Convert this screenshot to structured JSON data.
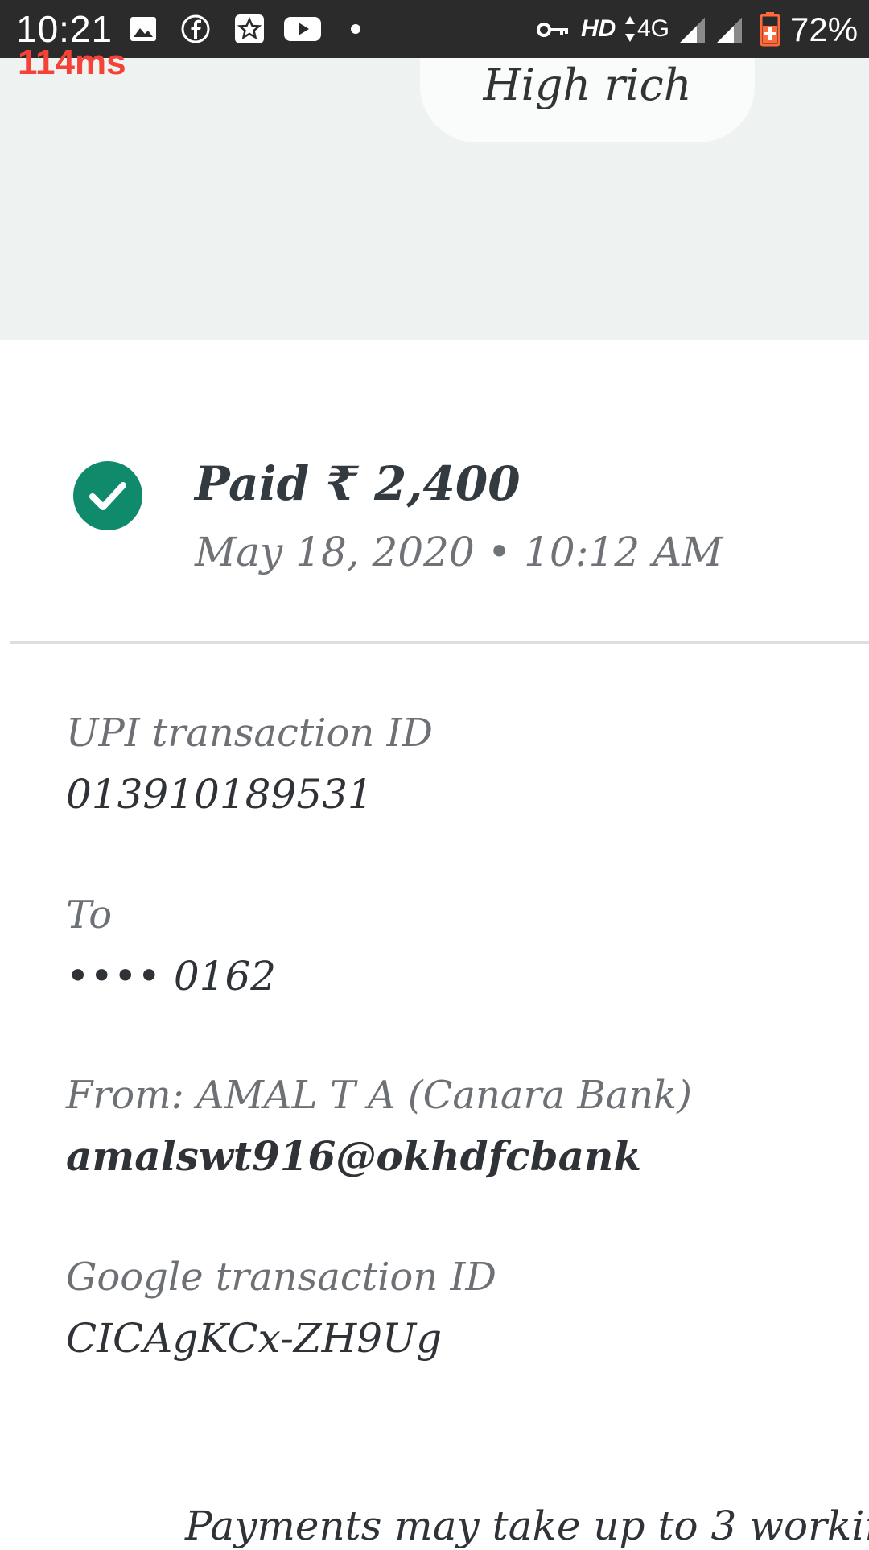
{
  "status_bar": {
    "time": "10:21",
    "perf_overlay": "114ms",
    "hd": "HD",
    "network": "4G",
    "battery": "72%",
    "icons": [
      "gallery-icon",
      "facebook-icon",
      "star-app-icon",
      "youtube-icon",
      "notification-dot",
      "vpn-key-icon",
      "data-arrows-icon",
      "signal-icon",
      "signal-icon",
      "battery-icon"
    ]
  },
  "note": {
    "text": "High rich"
  },
  "payment": {
    "status": "Paid ₹ 2,400",
    "datetime": "May 18, 2020 • 10:12 AM",
    "status_color": "#0f8a6a"
  },
  "details": [
    {
      "label": "UPI transaction ID",
      "value": "013910189531"
    },
    {
      "label": "To",
      "value": "•••• 0162"
    },
    {
      "label": "From: AMAL T A (Canara Bank)",
      "value": "amalswt916@okhdfcbank"
    },
    {
      "label": "Google transaction ID",
      "value": "CICAgKCx-ZH9Ug"
    }
  ],
  "footer": {
    "text": "Payments may take up to 3 workin"
  }
}
